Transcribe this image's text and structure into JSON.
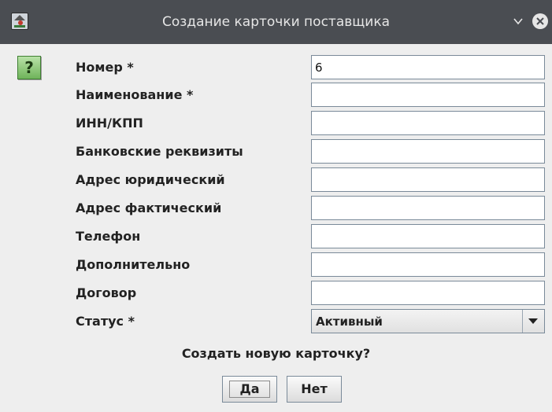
{
  "window": {
    "title": "Создание карточки поставщика",
    "app_icon": "supplier-app-icon",
    "controls": {
      "minimize_icon": "chevron-down-icon",
      "close_icon": "close-circle-icon"
    }
  },
  "help_icon": {
    "glyph": "?",
    "name": "help-question-icon"
  },
  "form": {
    "fields": [
      {
        "label": "Номер *",
        "value": "6"
      },
      {
        "label": "Наименование *",
        "value": ""
      },
      {
        "label": "ИНН/КПП",
        "value": ""
      },
      {
        "label": "Банковские реквизиты",
        "value": ""
      },
      {
        "label": "Адрес юридический",
        "value": ""
      },
      {
        "label": "Адрес фактический",
        "value": ""
      },
      {
        "label": "Телефон",
        "value": ""
      },
      {
        "label": "Дополнительно",
        "value": ""
      },
      {
        "label": "Договор",
        "value": ""
      }
    ],
    "status": {
      "label": "Статус *",
      "selected": "Активный"
    }
  },
  "prompt": {
    "question": "Создать новую карточку?",
    "yes_label": "Да",
    "no_label": "Нет"
  },
  "colors": {
    "titlebar": "#4a4d52",
    "background": "#eeeeee",
    "help_icon": "#6fb45a"
  }
}
